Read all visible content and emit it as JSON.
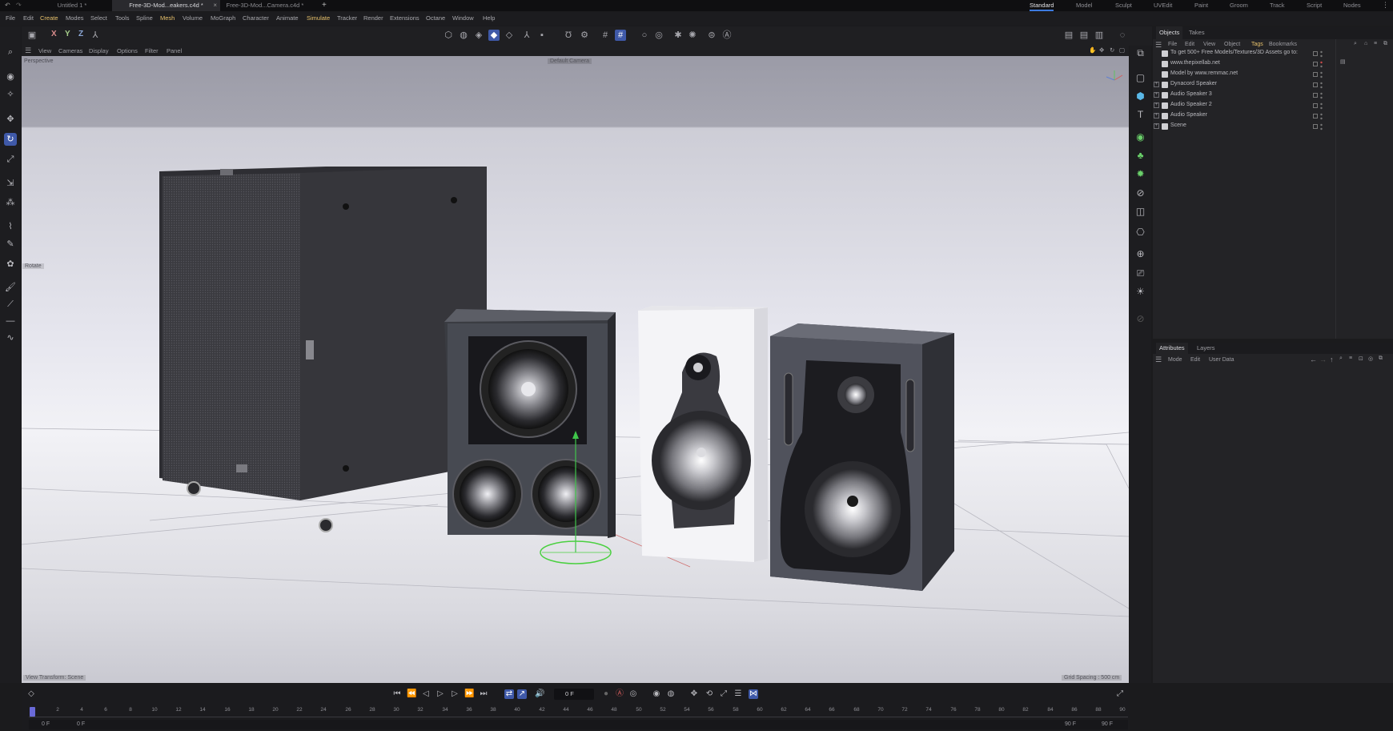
{
  "title_bar": {
    "doc_tabs": [
      {
        "label": "Untitled 1 *",
        "active": false
      },
      {
        "label": "Free-3D-Mod...eakers.c4d *",
        "active": true
      },
      {
        "label": "Free-3D-Mod...Camera.c4d *",
        "active": false
      }
    ],
    "new_tab": "+",
    "layouts": [
      "Standard",
      "Model",
      "Sculpt",
      "UVEdit",
      "Paint",
      "Groom",
      "Track",
      "Script",
      "Nodes"
    ],
    "active_layout": "Standard"
  },
  "menu": [
    "File",
    "Edit",
    "Create",
    "Modes",
    "Select",
    "Tools",
    "Spline",
    "Mesh",
    "Volume",
    "MoGraph",
    "Character",
    "Animate",
    "Simulate",
    "Tracker",
    "Render",
    "Extensions",
    "Octane",
    "Window",
    "Help"
  ],
  "toolbar": {
    "axes": [
      "X",
      "Y",
      "Z"
    ]
  },
  "viewport": {
    "menu": [
      "View",
      "Cameras",
      "Display",
      "Options",
      "Filter",
      "Panel"
    ],
    "view_name": "Perspective",
    "camera": "Default Camera",
    "hud_tool": "Rotate",
    "status_left": "View Transform: Scene",
    "status_right": "Grid Spacing : 500 cm"
  },
  "objects_panel": {
    "tabs": [
      "Objects",
      "Takes"
    ],
    "menu": [
      "File",
      "Edit",
      "View",
      "Object",
      "Tags",
      "Bookmarks"
    ],
    "items": [
      {
        "name": "To get 500+ Free Models/Textures/3D Assets go to:",
        "expandable": false
      },
      {
        "name": "www.thepixellab.net",
        "expandable": false
      },
      {
        "name": "Model by www.remmac.net",
        "expandable": false
      },
      {
        "name": "Dynacord Speaker",
        "expandable": true
      },
      {
        "name": "Audio Speaker 3",
        "expandable": true
      },
      {
        "name": "Audio Speaker 2",
        "expandable": true
      },
      {
        "name": "Audio Speaker",
        "expandable": true
      },
      {
        "name": "Scene",
        "expandable": true
      }
    ]
  },
  "attributes_panel": {
    "tabs": [
      "Attributes",
      "Layers"
    ],
    "menu": [
      "Mode",
      "Edit",
      "User Data"
    ]
  },
  "timeline": {
    "current_frame": "0 F",
    "ticks": [
      "0",
      "2",
      "4",
      "6",
      "8",
      "10",
      "12",
      "14",
      "16",
      "18",
      "20",
      "22",
      "24",
      "26",
      "28",
      "30",
      "32",
      "34",
      "36",
      "38",
      "40",
      "42",
      "44",
      "46",
      "48",
      "50",
      "52",
      "54",
      "56",
      "58",
      "60",
      "62",
      "64",
      "66",
      "68",
      "70",
      "72",
      "74",
      "76",
      "78",
      "80",
      "82",
      "84",
      "86",
      "88",
      "90"
    ],
    "start_a": "0 F",
    "start_b": "0 F",
    "end_a": "90 F",
    "end_b": "90 F"
  },
  "colors": {
    "accent": "#3f59a8",
    "menu_highlight": "#e6c06b"
  }
}
